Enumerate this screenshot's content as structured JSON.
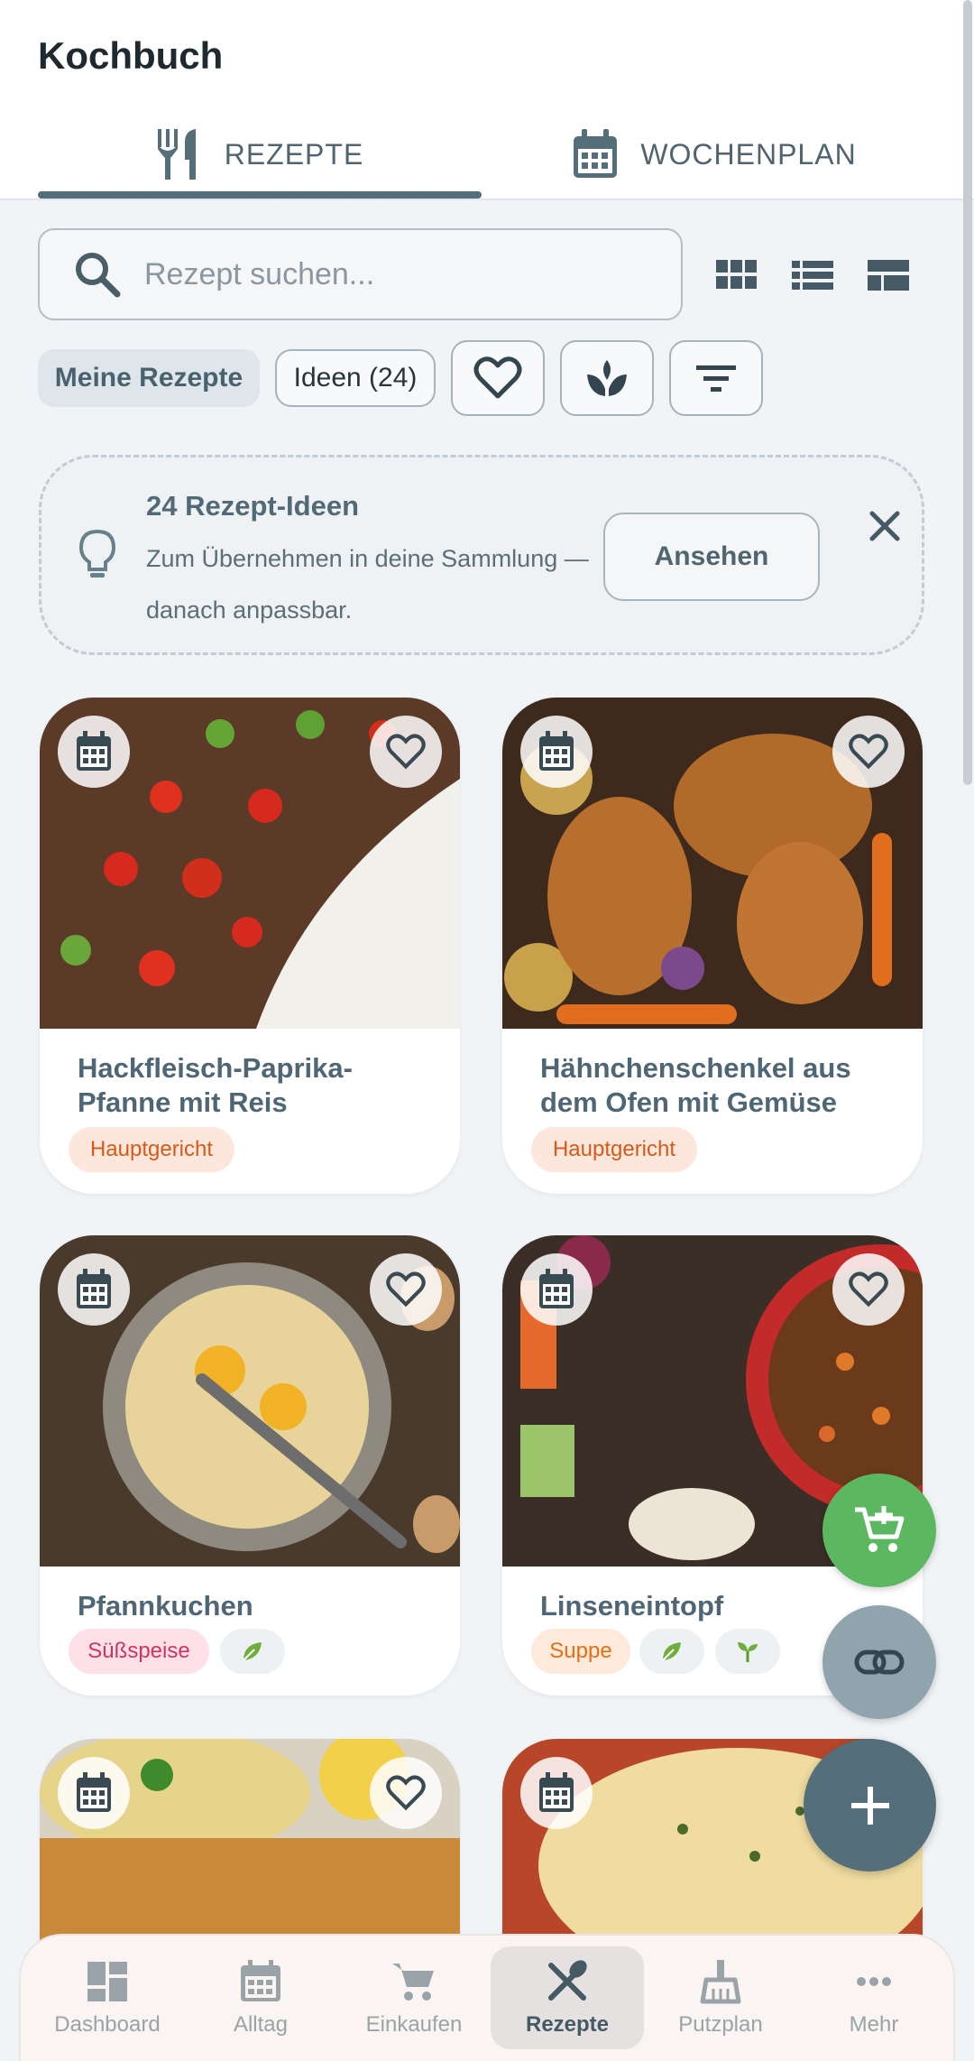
{
  "app": {
    "title": "Kochbuch"
  },
  "tabs": [
    {
      "label": "REZEPTE",
      "icon": "cutlery-icon",
      "active": true
    },
    {
      "label": "WOCHENPLAN",
      "icon": "calendar-icon",
      "active": false
    }
  ],
  "search": {
    "placeholder": "Rezept suchen...",
    "value": ""
  },
  "view_modes": [
    "grid-view-icon",
    "list-view-icon",
    "compact-view-icon"
  ],
  "filters": {
    "mine_label": "Meine Rezepte",
    "ideas_label": "Ideen (24)",
    "icon_filters": [
      "heart-icon",
      "sprout-icon",
      "filter-icon"
    ]
  },
  "banner": {
    "title": "24 Rezept-Ideen",
    "text": "Zum Übernehmen in deine Sammlung — danach anpassbar.",
    "button_label": "Ansehen"
  },
  "recipes": [
    {
      "title": "Hackfleisch-Paprika-Pfanne mit Reis",
      "category": "Hauptgericht",
      "extras": []
    },
    {
      "title": "Hähnchenschenkel aus dem Ofen mit Gemüse",
      "category": "Hauptgericht",
      "extras": []
    },
    {
      "title": "Pfannkuchen",
      "category": "Süßspeise",
      "extras": [
        "leaf-icon"
      ]
    },
    {
      "title": "Linseneintopf",
      "category": "Suppe",
      "extras": [
        "leaf-icon",
        "sprout-icon"
      ]
    }
  ],
  "bottom_nav": [
    {
      "label": "Dashboard",
      "icon": "dashboard-icon",
      "active": false
    },
    {
      "label": "Alltag",
      "icon": "calendar-icon",
      "active": false
    },
    {
      "label": "Einkaufen",
      "icon": "cart-icon",
      "active": false
    },
    {
      "label": "Rezepte",
      "icon": "cutlery-icon",
      "active": true
    },
    {
      "label": "Putzplan",
      "icon": "broom-icon",
      "active": false
    },
    {
      "label": "Mehr",
      "icon": "more-icon",
      "active": false
    }
  ],
  "colors": {
    "primary": "#546e7a",
    "fab_cart": "#5cb860",
    "fab_link": "#90a4ae",
    "tag_main": "#d65a18",
    "tag_sweet": "#d2335f",
    "tag_soup": "#e56f14"
  }
}
